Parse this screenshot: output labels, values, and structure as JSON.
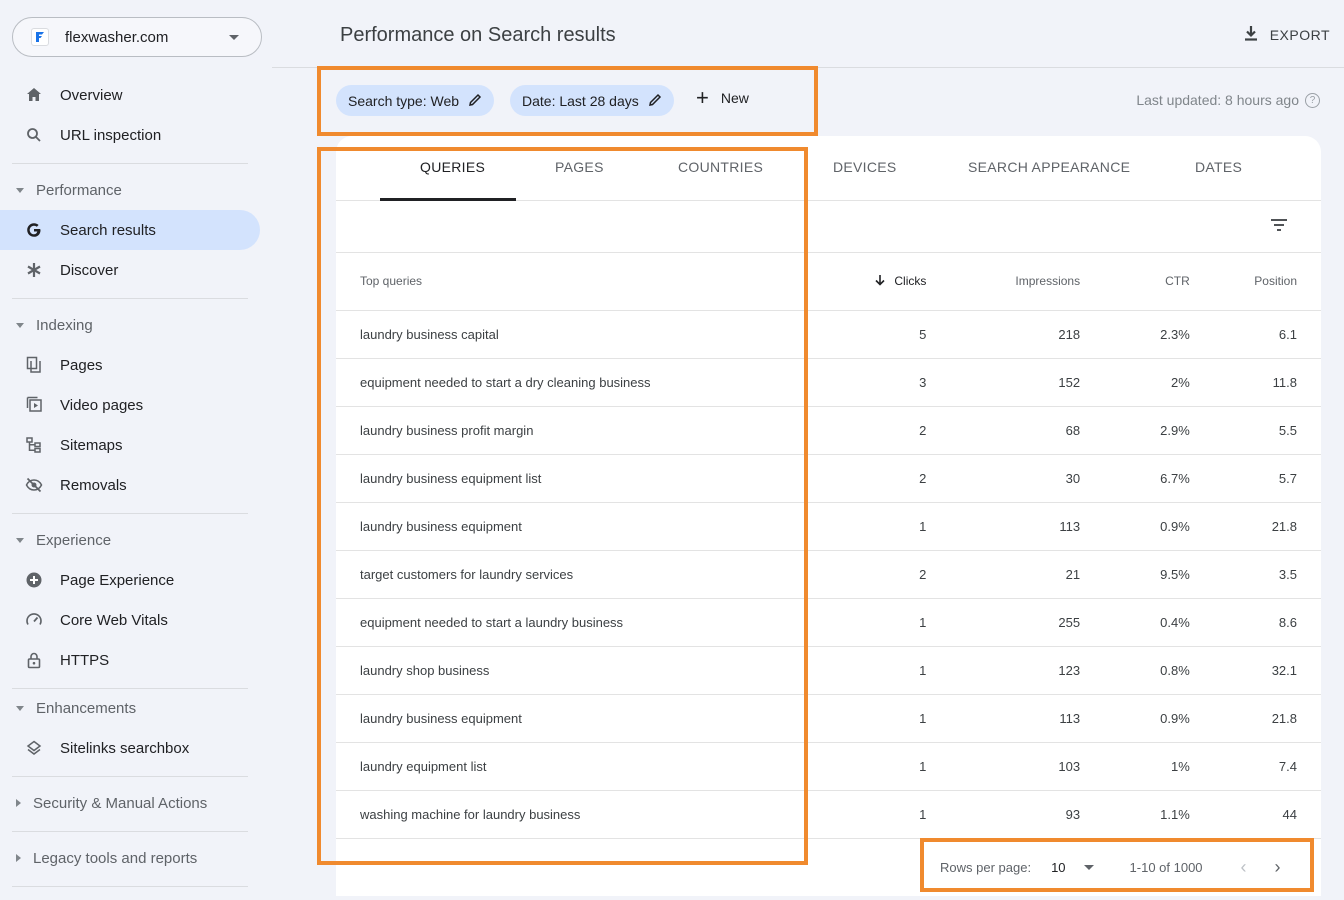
{
  "property": {
    "name": "flexwasher.com"
  },
  "nav": {
    "overview": "Overview",
    "url_inspection": "URL inspection",
    "performance_section": "Performance",
    "search_results": "Search results",
    "discover": "Discover",
    "indexing_section": "Indexing",
    "pages": "Pages",
    "video_pages": "Video pages",
    "sitemaps": "Sitemaps",
    "removals": "Removals",
    "experience_section": "Experience",
    "page_experience": "Page Experience",
    "core_web_vitals": "Core Web Vitals",
    "https": "HTTPS",
    "enhancements_section": "Enhancements",
    "sitelinks_searchbox": "Sitelinks searchbox",
    "security_section": "Security & Manual Actions",
    "legacy_section": "Legacy tools and reports"
  },
  "header": {
    "title": "Performance on Search results",
    "export_label": "EXPORT",
    "last_updated": "Last updated: 8 hours ago"
  },
  "filters": {
    "search_type": "Search type: Web",
    "date": "Date: Last 28 days",
    "new_label": "New"
  },
  "tabs": [
    "QUERIES",
    "PAGES",
    "COUNTRIES",
    "DEVICES",
    "SEARCH APPEARANCE",
    "DATES"
  ],
  "table": {
    "columns": {
      "query": "Top queries",
      "clicks": "Clicks",
      "impressions": "Impressions",
      "ctr": "CTR",
      "position": "Position"
    },
    "rows": [
      {
        "query": "laundry business capital",
        "clicks": "5",
        "impressions": "218",
        "ctr": "2.3%",
        "position": "6.1"
      },
      {
        "query": "equipment needed to start a dry cleaning business",
        "clicks": "3",
        "impressions": "152",
        "ctr": "2%",
        "position": "11.8"
      },
      {
        "query": "laundry business profit margin",
        "clicks": "2",
        "impressions": "68",
        "ctr": "2.9%",
        "position": "5.5"
      },
      {
        "query": "laundry business equipment list",
        "clicks": "2",
        "impressions": "30",
        "ctr": "6.7%",
        "position": "5.7"
      },
      {
        "query": "laundry business equipment",
        "clicks": "1",
        "impressions": "113",
        "ctr": "0.9%",
        "position": "21.8"
      },
      {
        "query": "target customers for laundry services",
        "clicks": "2",
        "impressions": "21",
        "ctr": "9.5%",
        "position": "3.5"
      },
      {
        "query": "equipment needed to start a laundry business",
        "clicks": "1",
        "impressions": "255",
        "ctr": "0.4%",
        "position": "8.6"
      },
      {
        "query": "laundry shop business",
        "clicks": "1",
        "impressions": "123",
        "ctr": "0.8%",
        "position": "32.1"
      },
      {
        "query": "laundry business equipment",
        "clicks": "1",
        "impressions": "113",
        "ctr": "0.9%",
        "position": "21.8"
      },
      {
        "query": "laundry equipment list",
        "clicks": "1",
        "impressions": "103",
        "ctr": "1%",
        "position": "7.4"
      },
      {
        "query": "washing machine for laundry business",
        "clicks": "1",
        "impressions": "93",
        "ctr": "1.1%",
        "position": "44"
      }
    ]
  },
  "pager": {
    "rows_per_page_label": "Rows per page:",
    "rows_per_page": "10",
    "range": "1-10 of 1000"
  },
  "colors": {
    "highlight": "#f08a2e",
    "clicks": "#1a73e8",
    "impressions": "#8430ce",
    "ctr": "#188038",
    "position": "#e37400",
    "active_nav": "#d3e3fd"
  }
}
